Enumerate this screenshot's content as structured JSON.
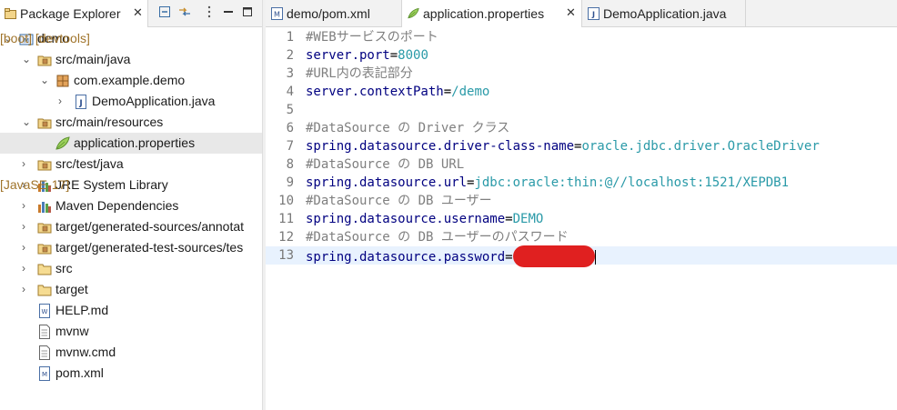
{
  "explorer": {
    "tab_label": "Package Explorer",
    "tree": [
      {
        "label": "demo",
        "deco": " [boot] [devtools]",
        "icon": "maven-project-icon",
        "chev": "⌄"
      },
      {
        "label": "src/main/java",
        "deco": "",
        "icon": "source-folder-icon",
        "chev": "⌄"
      },
      {
        "label": "com.example.demo",
        "deco": "",
        "icon": "package-icon",
        "chev": "⌄"
      },
      {
        "label": "DemoApplication.java",
        "deco": "",
        "icon": "java-file-icon",
        "chev": "›"
      },
      {
        "label": "src/main/resources",
        "deco": "",
        "icon": "source-folder-icon",
        "chev": "⌄"
      },
      {
        "label": "application.properties",
        "deco": "",
        "icon": "properties-file-icon",
        "chev": ""
      },
      {
        "label": "src/test/java",
        "deco": "",
        "icon": "source-folder-icon",
        "chev": "›"
      },
      {
        "label": "JRE System Library",
        "deco": " [JavaSE-17]",
        "icon": "library-icon",
        "chev": "›"
      },
      {
        "label": "Maven Dependencies",
        "deco": "",
        "icon": "library-icon",
        "chev": "›"
      },
      {
        "label": "target/generated-sources/annotat",
        "deco": "",
        "icon": "source-folder-icon",
        "chev": "›"
      },
      {
        "label": "target/generated-test-sources/tes",
        "deco": "",
        "icon": "source-folder-icon",
        "chev": "›"
      },
      {
        "label": "src",
        "deco": "",
        "icon": "folder-icon",
        "chev": "›"
      },
      {
        "label": "target",
        "deco": "",
        "icon": "folder-icon",
        "chev": "›"
      },
      {
        "label": "HELP.md",
        "deco": "",
        "icon": "markdown-file-icon",
        "chev": ""
      },
      {
        "label": "mvnw",
        "deco": "",
        "icon": "file-icon",
        "chev": ""
      },
      {
        "label": "mvnw.cmd",
        "deco": "",
        "icon": "file-icon",
        "chev": ""
      },
      {
        "label": "pom.xml",
        "deco": "",
        "icon": "xml-file-icon",
        "chev": ""
      }
    ]
  },
  "editor": {
    "tabs": [
      {
        "label": "demo/pom.xml",
        "icon": "xml-file-icon"
      },
      {
        "label": "application.properties",
        "icon": "properties-file-icon"
      },
      {
        "label": "DemoApplication.java",
        "icon": "java-file-icon"
      }
    ],
    "active_tab": 1,
    "lines": [
      {
        "num": "1",
        "parts": [
          {
            "t": "#WEBサービスのポート",
            "c": "c"
          }
        ]
      },
      {
        "num": "2",
        "parts": [
          {
            "t": "server.port",
            "c": "k"
          },
          {
            "t": "=",
            "c": "o"
          },
          {
            "t": "8000",
            "c": "v"
          }
        ]
      },
      {
        "num": "3",
        "parts": [
          {
            "t": "#URL内の表記部分",
            "c": "c"
          }
        ]
      },
      {
        "num": "4",
        "parts": [
          {
            "t": "server.contextPath",
            "c": "k"
          },
          {
            "t": "=",
            "c": "o"
          },
          {
            "t": "/demo",
            "c": "v"
          }
        ]
      },
      {
        "num": "5",
        "parts": []
      },
      {
        "num": "6",
        "parts": [
          {
            "t": "#DataSource の Driver クラス",
            "c": "c"
          }
        ]
      },
      {
        "num": "7",
        "parts": [
          {
            "t": "spring.datasource.driver-class-name",
            "c": "k"
          },
          {
            "t": "=",
            "c": "o"
          },
          {
            "t": "oracle.jdbc.driver.OracleDriver",
            "c": "v"
          }
        ]
      },
      {
        "num": "8",
        "parts": [
          {
            "t": "#DataSource の DB URL",
            "c": "c"
          }
        ]
      },
      {
        "num": "9",
        "parts": [
          {
            "t": "spring.datasource.url",
            "c": "k"
          },
          {
            "t": "=",
            "c": "o"
          },
          {
            "t": "jdbc:oracle:thin:@//localhost:1521/XEPDB1",
            "c": "v"
          }
        ]
      },
      {
        "num": "10",
        "parts": [
          {
            "t": "#DataSource の DB ユーザー",
            "c": "c"
          }
        ]
      },
      {
        "num": "11",
        "parts": [
          {
            "t": "spring.datasource.username",
            "c": "k"
          },
          {
            "t": "=",
            "c": "o"
          },
          {
            "t": "DEMO",
            "c": "v"
          }
        ]
      },
      {
        "num": "12",
        "parts": [
          {
            "t": "#DataSource の DB ユーザーのパスワード",
            "c": "c"
          }
        ]
      },
      {
        "num": "13",
        "parts": [
          {
            "t": "spring.datasource.password",
            "c": "k"
          },
          {
            "t": "=",
            "c": "o"
          }
        ],
        "redacted": true
      }
    ],
    "current_line": 13
  },
  "colors": {
    "comment": "#7f7f7f",
    "key": "#000080",
    "value": "#2a9aa8",
    "redaction": "#e02020",
    "current_line_bg": "#e8f2fe",
    "selection_bg": "#e8e8e8",
    "decoration": "#a0742b"
  }
}
